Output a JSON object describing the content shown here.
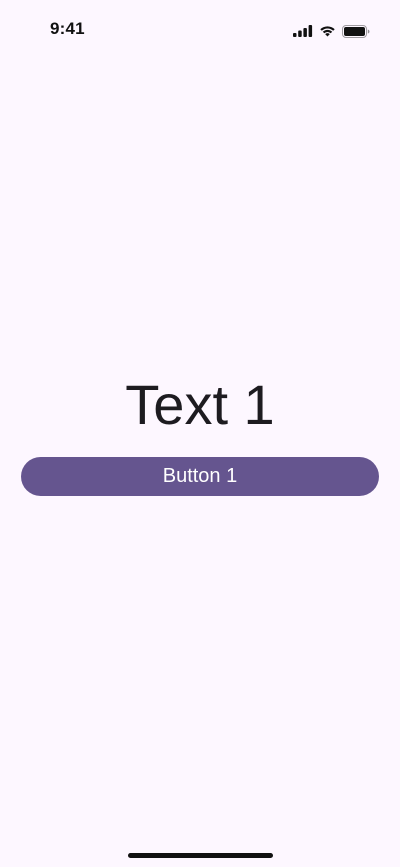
{
  "status_bar": {
    "time": "9:41",
    "icons": [
      "cellular-signal-icon",
      "wifi-icon",
      "battery-icon"
    ]
  },
  "main": {
    "text": "Text 1",
    "button_label": "Button 1"
  },
  "colors": {
    "background": "#FDF7FF",
    "primary": "#65558F",
    "on_primary": "#FFFFFF",
    "text": "#1D1B20"
  }
}
